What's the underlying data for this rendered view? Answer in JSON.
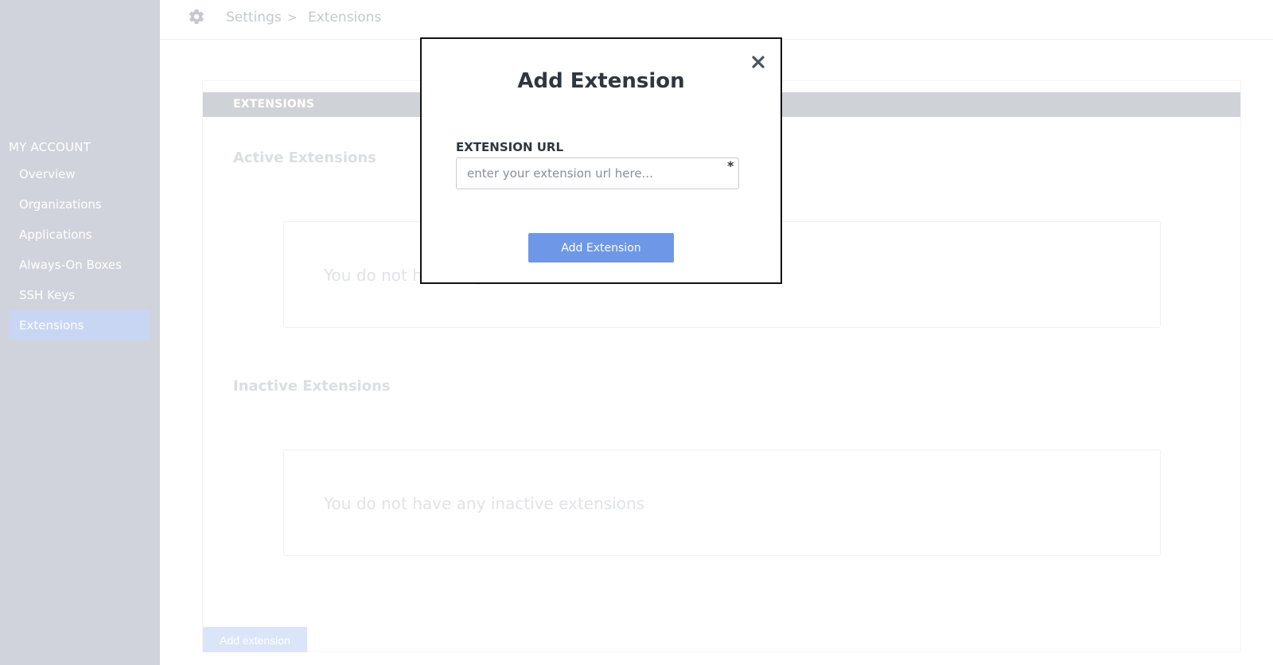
{
  "sidebar": {
    "heading": "MY ACCOUNT",
    "items": [
      {
        "label": "Overview"
      },
      {
        "label": "Organizations"
      },
      {
        "label": "Applications"
      },
      {
        "label": "Always-On Boxes"
      },
      {
        "label": "SSH Keys"
      },
      {
        "label": "Extensions",
        "active": true
      }
    ]
  },
  "breadcrumb": {
    "icon": "gear-icon",
    "items": [
      "Settings",
      "Extensions"
    ],
    "separator": ">"
  },
  "card": {
    "header": "EXTENSIONS",
    "active_title": "Active Extensions",
    "active_empty": "You do not have any active extensions",
    "inactive_title": "Inactive Extensions",
    "inactive_empty": "You do not have any inactive extensions",
    "add_button": "Add extension"
  },
  "modal": {
    "title": "Add Extension",
    "close_icon": "close-icon",
    "field_label": "EXTENSION URL",
    "field_placeholder": "enter your extension url here...",
    "field_value": "",
    "required_marker": "*",
    "submit_label": "Add Extension"
  },
  "colors": {
    "sidebar_bg": "#d0d3db",
    "active_item_bg": "#c8d6f4",
    "primary_button": "#6e97e7",
    "card_header_bg": "#cfd2d6"
  }
}
